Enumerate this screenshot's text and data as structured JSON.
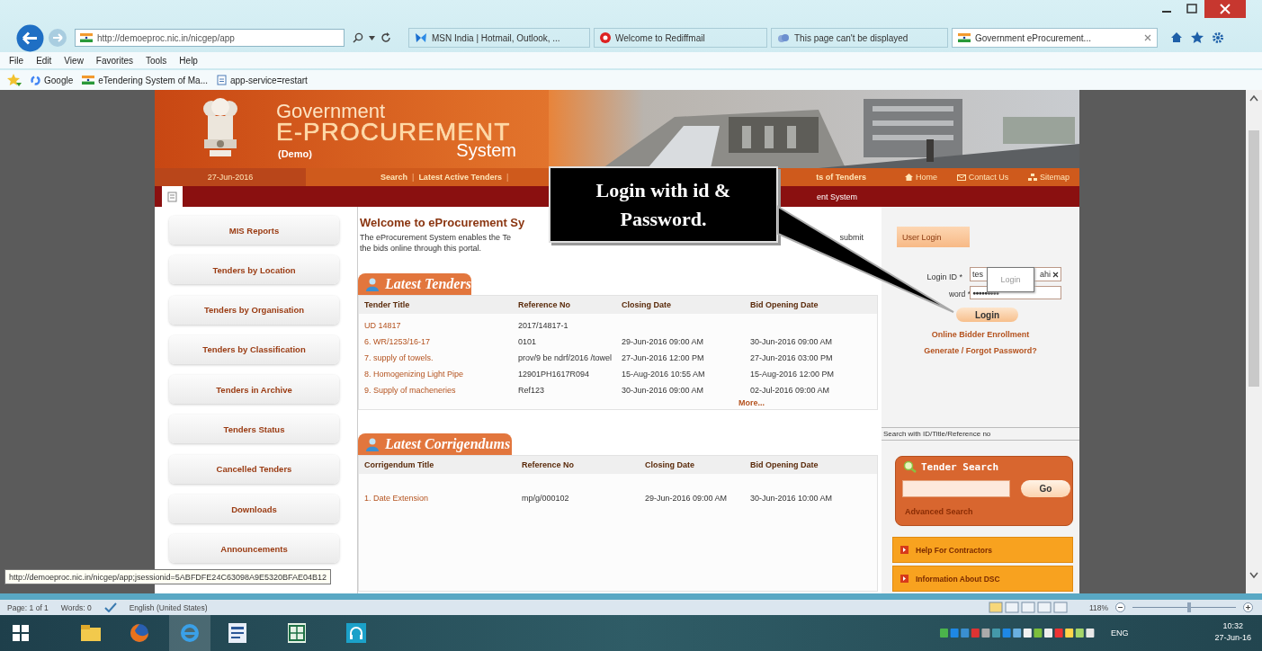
{
  "browser": {
    "address": "http://demoeproc.nic.in/nicgep/app",
    "tabs": [
      {
        "label": "MSN India | Hotmail, Outlook, ...",
        "selected": false
      },
      {
        "label": "Welcome to Rediffmail",
        "selected": false
      },
      {
        "label": "This page can't be displayed",
        "selected": false
      },
      {
        "label": "Government eProcurement...",
        "selected": true
      }
    ],
    "menu": [
      "File",
      "Edit",
      "View",
      "Favorites",
      "Tools",
      "Help"
    ],
    "favorites": [
      "Google",
      "eTendering System of Ma...",
      "app-service=restart"
    ]
  },
  "site": {
    "title": "Government",
    "title_main": "E-PROCUREMENT",
    "edition": "(Demo)",
    "title_end": "System",
    "date": "27-Jun-2016",
    "nav": [
      {
        "label": "Search",
        "kind": "link"
      },
      {
        "label": "|",
        "kind": "separator"
      },
      {
        "label": "Latest Active Tenders",
        "kind": "link"
      },
      {
        "label": "|",
        "kind": "separator"
      }
    ],
    "nav_partial": "ts of Tenders",
    "top_links": [
      "Home",
      "Contact Us",
      "Sitemap"
    ],
    "bar_partial": "ent System"
  },
  "sidebar": [
    "MIS Reports",
    "Tenders by Location",
    "Tenders by Organisation",
    "Tenders by Classification",
    "Tenders in Archive",
    "Tenders Status",
    "Cancelled Tenders",
    "Downloads",
    "Announcements"
  ],
  "welcome": {
    "heading": "Welcome to eProcurement Sy",
    "intro_start": "The eProcurement System enables the Te",
    "intro_end": "submit",
    "intro_line2": "the bids online through this portal."
  },
  "tenders": {
    "title": "Latest Tenders",
    "columns": [
      "Tender Title",
      "Reference No",
      "Closing Date",
      "Bid Opening Date"
    ],
    "rows": [
      {
        "title": "UD 14817",
        "reference": "2017/14817-1"
      },
      {
        "title": "6. WR/1253/16-17",
        "reference": "0101",
        "closing": "29-Jun-2016 09:00 AM",
        "opening": "30-Jun-2016 09:00 AM"
      },
      {
        "title": "7. supply of towels.",
        "reference": "prov/9 be ndrf/2016 /towel",
        "closing": "27-Jun-2016 12:00 PM",
        "opening": "27-Jun-2016 03:00 PM"
      },
      {
        "title": "8. Homogenizing Light Pipe",
        "reference": "12901PH1617R094",
        "closing": "15-Aug-2016 10:55 AM",
        "opening": "15-Aug-2016 12:00 PM"
      },
      {
        "title": "9. Supply of macheneries",
        "reference": "Ref123",
        "closing": "30-Jun-2016 09:00 AM",
        "opening": "02-Jul-2016 09:00 AM"
      }
    ],
    "more": "More..."
  },
  "corrigendums": {
    "title": "Latest Corrigendums",
    "columns": [
      "Corrigendum Title",
      "Reference No",
      "Closing Date",
      "Bid Opening Date"
    ],
    "rows": [
      {
        "title": "1. Date Extension",
        "reference": "mp/g/000102",
        "closing": "29-Jun-2016 09:00 AM",
        "opening": "30-Jun-2016 10:00 AM"
      }
    ]
  },
  "login": {
    "tab": "User Login",
    "id_label": "Login ID *",
    "id_start": "tes",
    "id_end": "ahi",
    "password_label": "word *",
    "password_value": "●●●●●●●●●",
    "tooltip": "Login",
    "button": "Login",
    "links": [
      "Online Bidder Enrollment",
      "Generate / Forgot Password?"
    ]
  },
  "search": {
    "hint": "Search with ID/Title/Reference no",
    "title": "Tender Search",
    "button": "Go",
    "advanced": "Advanced Search"
  },
  "accordion": [
    "Help For Contractors",
    "Information About DSC"
  ],
  "callout": "Login with id & Password.",
  "status_url": "http://demoeproc.nic.in/nicgep/app;jsessionid=5ABFDFE24C63098A9E5320BFAE04B12",
  "word_status": {
    "page": "Page: 1 of 1",
    "words": "Words: 0",
    "language": "English (United States)",
    "zoom": "118%",
    "zoom_slider": {
      "level": 0.55
    }
  },
  "taskbar": {
    "language": "ENG",
    "time": "10:32",
    "date": "27-Jun-16"
  }
}
